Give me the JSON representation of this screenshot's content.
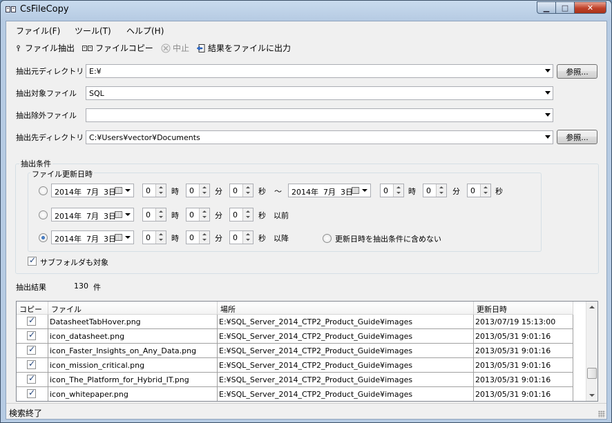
{
  "window": {
    "title": "CsFileCopy",
    "min_glyph": "▁",
    "max_glyph": "□",
    "close_glyph": "✕"
  },
  "menu": [
    "ファイル(F)",
    "ツール(T)",
    "ヘルプ(H)"
  ],
  "toolbar": [
    {
      "label": "ファイル抽出",
      "icon": "extract-icon",
      "enabled": true
    },
    {
      "label": "ファイルコピー",
      "icon": "copy-files-icon",
      "enabled": true
    },
    {
      "label": "中止",
      "icon": "stop-icon",
      "enabled": false
    },
    {
      "label": "結果をファイルに出力",
      "icon": "export-icon",
      "enabled": true
    }
  ],
  "form": {
    "source_dir": {
      "label": "抽出元ディレクトリ",
      "value": "E:¥",
      "browse": "参照..."
    },
    "target_files": {
      "label": "抽出対象ファイル",
      "value": "SQL"
    },
    "exclude_files": {
      "label": "抽出除外ファイル",
      "value": ""
    },
    "dest_dir": {
      "label": "抽出先ディレクトリ",
      "value": "C:¥Users¥vector¥Documents",
      "browse": "参照..."
    }
  },
  "conditions": {
    "group_title": "抽出条件",
    "date_group_title": "ファイル更新日時",
    "units": {
      "hour": "時",
      "minute": "分",
      "second": "秒"
    },
    "range_sep": "～",
    "rows": [
      {
        "selected": false,
        "from_date": "2014年  7月  3日",
        "h": "0",
        "m": "0",
        "s": "0",
        "to_date": "2014年  7月  3日",
        "th": "0",
        "tm": "0",
        "ts": "0"
      },
      {
        "selected": false,
        "date": "2014年  7月  3日",
        "h": "0",
        "m": "0",
        "s": "0",
        "suffix": "以前"
      },
      {
        "selected": true,
        "date": "2014年  7月  3日",
        "h": "0",
        "m": "0",
        "s": "0",
        "suffix": "以降"
      }
    ],
    "no_date_option": {
      "label": "更新日時を抽出条件に含めない",
      "selected": false
    },
    "subfolders": {
      "label": "サブフォルダも対象",
      "checked": true
    }
  },
  "result": {
    "label": "抽出結果",
    "count": "130",
    "unit": "件"
  },
  "grid": {
    "columns": [
      "コピー",
      "ファイル",
      "場所",
      "更新日時"
    ],
    "rows": [
      {
        "checked": true,
        "file": "DatasheetTabHover.png",
        "location": "E:¥SQL_Server_2014_CTP2_Product_Guide¥images",
        "modified": "2013/07/19 15:13:00"
      },
      {
        "checked": true,
        "file": "icon_datasheet.png",
        "location": "E:¥SQL_Server_2014_CTP2_Product_Guide¥images",
        "modified": "2013/05/31 9:01:16"
      },
      {
        "checked": true,
        "file": "icon_Faster_Insights_on_Any_Data.png",
        "location": "E:¥SQL_Server_2014_CTP2_Product_Guide¥images",
        "modified": "2013/05/31 9:01:16"
      },
      {
        "checked": true,
        "file": "icon_mission_critical.png",
        "location": "E:¥SQL_Server_2014_CTP2_Product_Guide¥images",
        "modified": "2013/05/31 9:01:16"
      },
      {
        "checked": true,
        "file": "icon_The_Platform_for_Hybrid_IT.png",
        "location": "E:¥SQL_Server_2014_CTP2_Product_Guide¥images",
        "modified": "2013/05/31 9:01:16"
      },
      {
        "checked": true,
        "file": "icon_whitepaper.png",
        "location": "E:¥SQL_Server_2014_CTP2_Product_Guide¥images",
        "modified": "2013/05/31 9:01:16"
      }
    ]
  },
  "status": "検索終了"
}
